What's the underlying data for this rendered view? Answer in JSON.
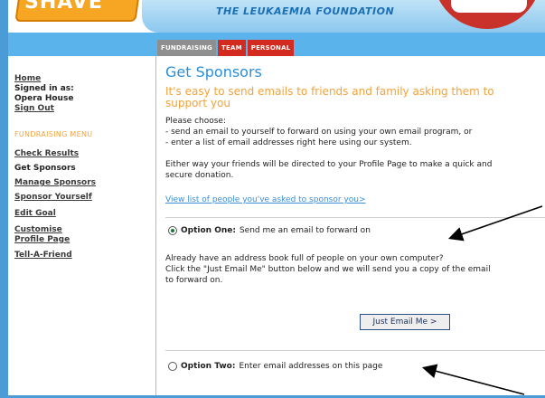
{
  "banner": {
    "logo_text": "SHAVE",
    "foundation": "THE LEUKAEMIA FOUNDATION"
  },
  "tabs": [
    {
      "label": "FUNDRAISING"
    },
    {
      "label": "TEAM"
    },
    {
      "label": "PERSONAL"
    }
  ],
  "sidebar": {
    "home": "Home",
    "signed_in_as": "Signed in as:",
    "user_name": "Opera House",
    "sign_out": "Sign Out",
    "menu_title": "FUNDRAISING MENU",
    "items": [
      {
        "label": "Check Results"
      },
      {
        "label": "Get Sponsors"
      },
      {
        "label": "Manage Sponsors"
      },
      {
        "label": "Sponsor Yourself"
      },
      {
        "label": "Edit Goal"
      },
      {
        "label": "Customise Profile Page"
      },
      {
        "label": "Tell-A-Friend"
      }
    ]
  },
  "main": {
    "title": "Get Sponsors",
    "subtitle": "It's easy to send emails to friends and family asking them to support you",
    "choose": "Please choose:",
    "choice1": "- send an email to yourself to forward on using your own email program, or",
    "choice2": "- enter a list of email addresses right here using our system.",
    "either_way_1": "Either way your friends will be directed to your Profile Page to make a quick and",
    "either_way_2": "secure donation.",
    "view_list_link": "View list of people you've asked to sponsor you>",
    "option_one_title": "Option One:",
    "option_one_text": "Send me an email to forward on",
    "option_one_desc_1": "Already have an address book full of people on your own computer?",
    "option_one_desc_2": "Click the \"Just Email Me\" button below and we will send you a copy of the email",
    "option_one_desc_3": "to forward on.",
    "just_email_button": "Just Email Me >",
    "option_two_title": "Option Two:",
    "option_two_text": "Enter email addresses on this page"
  },
  "colors": {
    "accent_blue": "#2b8fd8",
    "accent_orange": "#f4a23a",
    "tab_red": "#d32b1f",
    "nav_band": "#5ab3ea"
  }
}
